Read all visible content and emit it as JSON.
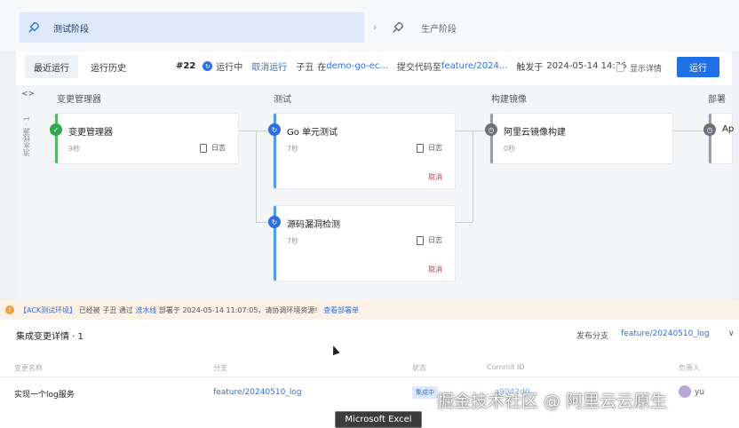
{
  "stages": {
    "active": {
      "label": "测试阶段",
      "icon": "rocket-icon"
    },
    "next": {
      "label": "生产阶段",
      "icon": "rocket-icon"
    }
  },
  "tabs": [
    {
      "label": "最近运行"
    },
    {
      "label": "运行历史"
    }
  ],
  "run": {
    "number": "#22",
    "status": "运行中",
    "cancel_label": "取消运行",
    "user": "子丑",
    "at_label": "在",
    "repo": "demo-go-ec...",
    "commit_label": "提交代码至",
    "branch": "feature/2024...",
    "trigger_label": "触发于",
    "time": "2024-05-14 14:36",
    "show_detail_label": "显示详情",
    "run_button": "运行"
  },
  "pipeline": {
    "side_toggle": "<>",
    "side_label": "流水线源 · 1",
    "columns": [
      "变更管理器",
      "测试",
      "构建镜像",
      "部署"
    ],
    "jobs": {
      "change_manager": {
        "title": "变更管理器",
        "duration": "9秒",
        "log": "日志",
        "status": "done"
      },
      "go_test": {
        "title": "Go 单元测试",
        "duration": "7秒",
        "log": "日志",
        "cancel": "取消",
        "status": "running"
      },
      "source_scan": {
        "title": "源码漏洞检测",
        "duration": "7秒",
        "log": "日志",
        "cancel": "取消",
        "status": "running"
      },
      "aliyun_image": {
        "title": "阿里云镜像构建",
        "duration": "0秒",
        "status": "waiting"
      },
      "deploy": {
        "title": "Ap",
        "status": "waiting"
      }
    }
  },
  "warning": {
    "env": "【ACK测试环境】",
    "pre": "已经被 子丑 通过",
    "link1": "流水线",
    "mid": "部署于 2024-05-14 11:07:05，请协调环境资源!",
    "link2": "查看部署单"
  },
  "integration": {
    "title": "集成变更详情 · 1",
    "release_label": "发布分支",
    "release_value": "feature/20240510_log",
    "toggle": "∨",
    "headers": [
      "变更名称",
      "分支",
      "状态",
      "Commit ID",
      "负责人"
    ],
    "row": {
      "name": "实现一个log服务",
      "branch": "feature/20240510_log",
      "status": "集成中",
      "commit": "...a9042d0...",
      "owner": "yu"
    }
  },
  "overlay": {
    "watermark": "掘金技术社区 @ 阿里云云原生",
    "tooltip": "Microsoft Excel"
  }
}
